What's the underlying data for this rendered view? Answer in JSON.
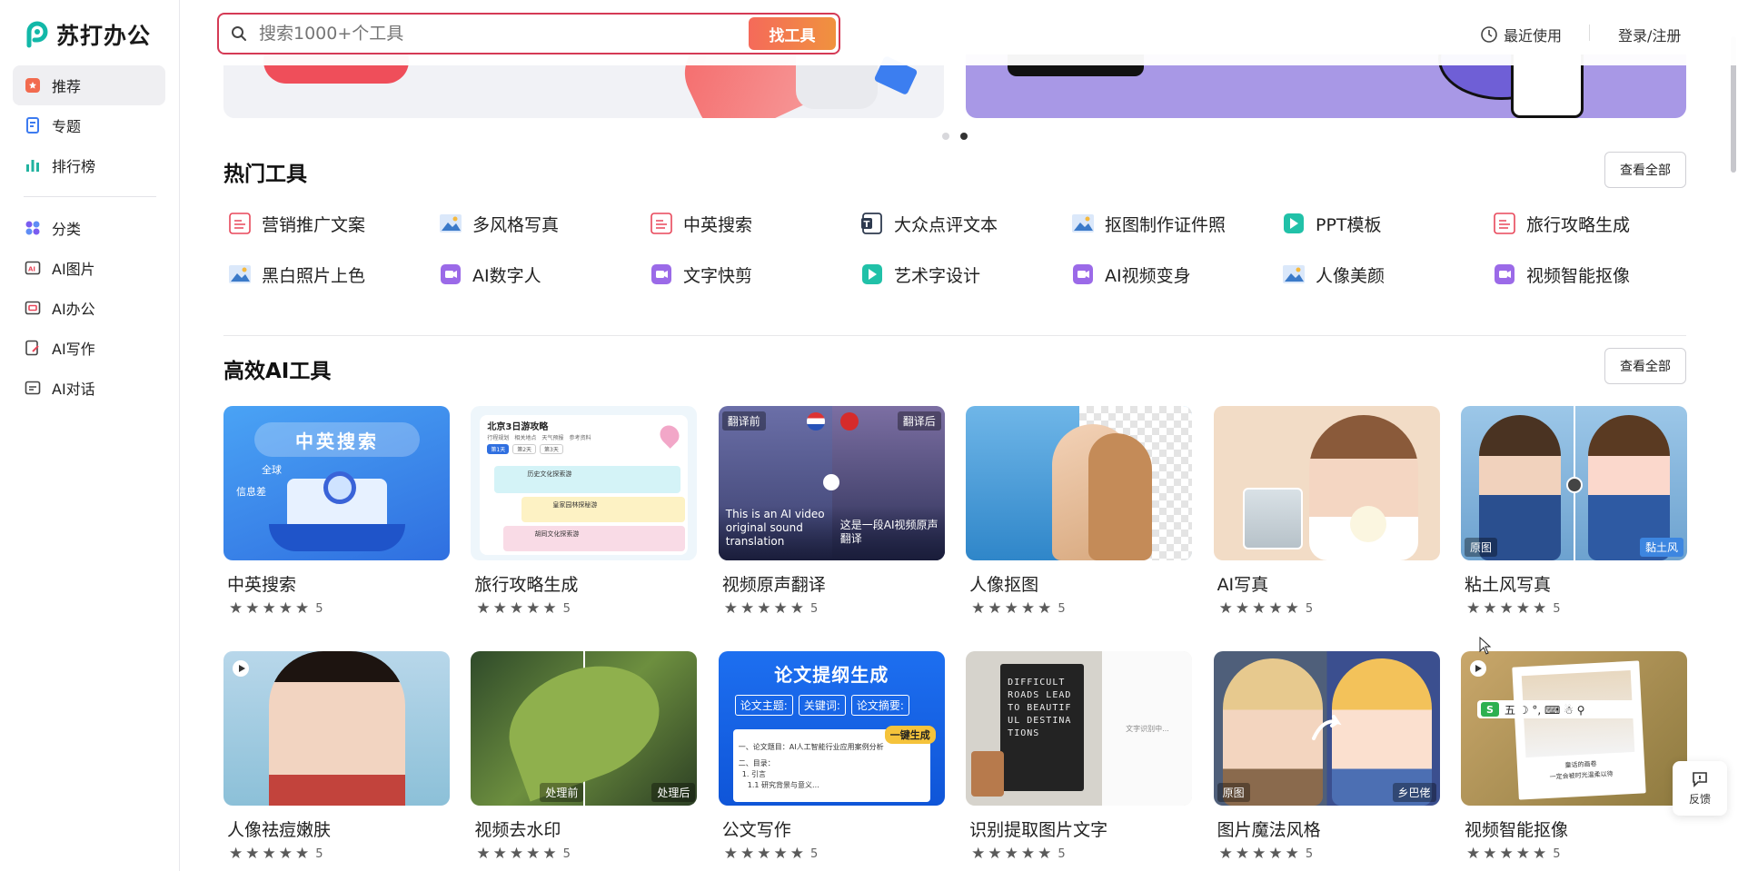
{
  "app": {
    "logo_text": "苏打办公"
  },
  "sidebar": {
    "items": [
      {
        "label": "推荐",
        "icon": "recommend-icon",
        "color": "#f26b4f",
        "active": true
      },
      {
        "label": "专题",
        "icon": "topic-icon",
        "color": "#3d7bf0"
      },
      {
        "label": "排行榜",
        "icon": "ranking-icon",
        "color": "#22b3a0"
      }
    ],
    "categories": [
      {
        "label": "分类",
        "icon": "category-icon",
        "color": "#7a5cf0"
      },
      {
        "label": "AI图片",
        "icon": "ai-image-icon",
        "color": "#555"
      },
      {
        "label": "AI办公",
        "icon": "ai-office-icon",
        "color": "#555"
      },
      {
        "label": "AI写作",
        "icon": "ai-writing-icon",
        "color": "#555"
      },
      {
        "label": "AI对话",
        "icon": "ai-chat-icon",
        "color": "#555"
      }
    ]
  },
  "header": {
    "search_placeholder": "搜索1000+个工具",
    "search_button": "找工具",
    "recent_label": "最近使用",
    "login_label": "登录/注册"
  },
  "hot_tools": {
    "title": "热门工具",
    "view_all": "查看全部",
    "items": [
      {
        "label": "营销推广文案",
        "icon": "pdf-icon",
        "color": "#e8475a"
      },
      {
        "label": "多风格写真",
        "icon": "image-icon",
        "color": "#3b7ac9"
      },
      {
        "label": "中英搜索",
        "icon": "pdf-icon",
        "color": "#e8475a"
      },
      {
        "label": "大众点评文本",
        "icon": "text-doc-icon",
        "color": "#2e3a4f"
      },
      {
        "label": "抠图制作证件照",
        "icon": "image-icon",
        "color": "#3b7ac9"
      },
      {
        "label": "PPT模板",
        "icon": "ppt-icon",
        "color": "#21c1a8"
      },
      {
        "label": "旅行攻略生成",
        "icon": "pdf-icon",
        "color": "#e8475a"
      },
      {
        "label": "黑白照片上色",
        "icon": "image-icon",
        "color": "#3b7ac9"
      },
      {
        "label": "AI数字人",
        "icon": "video-icon",
        "color": "#9b6ae8"
      },
      {
        "label": "文字快剪",
        "icon": "video-icon",
        "color": "#9b6ae8"
      },
      {
        "label": "艺术字设计",
        "icon": "ppt-icon",
        "color": "#21c1a8"
      },
      {
        "label": "AI视频变身",
        "icon": "video-icon",
        "color": "#9b6ae8"
      },
      {
        "label": "人像美颜",
        "icon": "image-icon",
        "color": "#3b7ac9"
      },
      {
        "label": "视频智能抠像",
        "icon": "video-icon",
        "color": "#9b6ae8"
      }
    ]
  },
  "ai_tools": {
    "title": "高效AI工具",
    "view_all": "查看全部",
    "cards": [
      {
        "title": "中英搜索",
        "rating": "5",
        "thumb_text": "中英搜索",
        "thumb_sub1": "全球",
        "thumb_sub2": "信息差"
      },
      {
        "title": "旅行攻略生成",
        "rating": "5",
        "thumb_text": "北京3日游攻略",
        "tab1": "行程规划",
        "tab2": "相关地点",
        "tab3": "天气预报",
        "tab4": "参考资料",
        "day1": "第1天",
        "day2": "第2天",
        "day3": "第3天",
        "row1": "历史文化探索游",
        "row2": "皇家园林探秘游",
        "row3": "胡同文化探索游"
      },
      {
        "title": "视频原声翻译",
        "rating": "5",
        "label_left": "翻译前",
        "label_right": "翻译后",
        "caption_left": "This is an AI video original sound translation",
        "caption_right": "这是一段AI视频原声翻译"
      },
      {
        "title": "人像抠图",
        "rating": "5"
      },
      {
        "title": "AI写真",
        "rating": "5"
      },
      {
        "title": "粘土风写真",
        "rating": "5",
        "label_left": "原图",
        "label_right": "黏土风"
      },
      {
        "title": "人像祛痘嫩肤",
        "rating": "5"
      },
      {
        "title": "视频去水印",
        "rating": "5",
        "label_left": "处理前",
        "label_right": "处理后"
      },
      {
        "title": "公文写作",
        "rating": "5",
        "thumb_text": "论文提纲生成",
        "field1": "论文主题:",
        "field2": "关键词:",
        "field3": "论文摘要:",
        "action": "一键生成",
        "line1": "一、论文题目：AI人工智能行业应用案例分析",
        "line2": "二、目录：",
        "line3": "1. 引言",
        "line4": "1.1 研究背景与意义..."
      },
      {
        "title": "识别提取图片文字",
        "rating": "5",
        "board_text": "DIFFICULT ROADS LEAD TO BEAUTIFUL DESTINATIONS",
        "side_text": "文字识别中..."
      },
      {
        "title": "图片魔法风格",
        "rating": "5",
        "label_left": "原图",
        "label_right": "乡巴佬"
      },
      {
        "title": "视频智能抠像",
        "rating": "5",
        "caption1": "童话的画卷",
        "caption2": "一定会被时光温柔以待"
      }
    ]
  },
  "feedback_label": "反馈",
  "colors": {
    "accent": "#d53a55",
    "search_btn_start": "#f56a5a",
    "search_btn_end": "#f0923e"
  }
}
